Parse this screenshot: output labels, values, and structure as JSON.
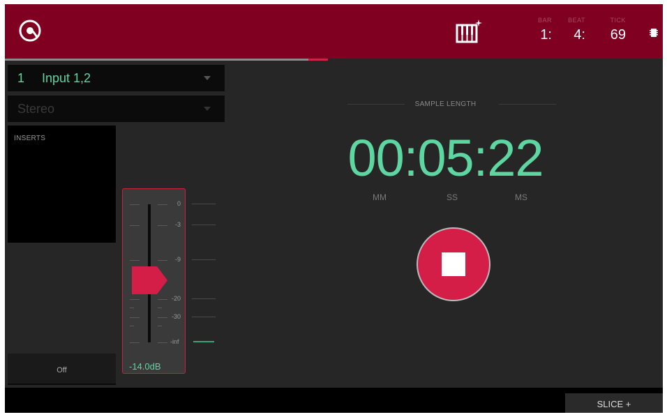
{
  "header": {
    "logo_icon": "record-disc-icon",
    "keys_icon": "keyboard-sparkle-icon",
    "counters": [
      {
        "label": "BAR",
        "value": "1:"
      },
      {
        "label": "BEAT",
        "value": "4:"
      },
      {
        "label": "TICK",
        "value": "69"
      }
    ],
    "chip_icon": "chip-icon",
    "accent_color": "#7f0020"
  },
  "input": {
    "track_number": "1",
    "source": "Input 1,2",
    "mode": "Stereo"
  },
  "inserts": {
    "title": "INSERTS",
    "off_label": "Off"
  },
  "fader": {
    "scale": [
      "0",
      "-3",
      "-9",
      "-20",
      "-30",
      "-inf"
    ],
    "value_label": "-14.0dB",
    "color": "#c8203e"
  },
  "sample": {
    "length_label": "SAMPLE LENGTH",
    "time": "00:05:22",
    "units": [
      "MM",
      "SS",
      "MS"
    ],
    "time_color": "#5ed6a2"
  },
  "transport": {
    "stop_icon": "stop-icon"
  },
  "bottom": {
    "slice_label": "SLICE +"
  }
}
